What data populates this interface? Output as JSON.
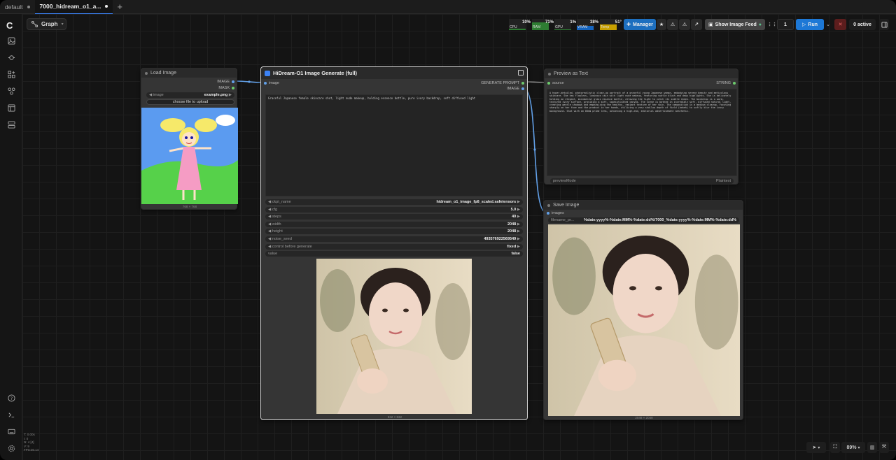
{
  "tabs": [
    {
      "label": "default"
    },
    {
      "label": "7000_hidream_o1_a..."
    }
  ],
  "toolbar": {
    "graph_label": "Graph",
    "meters": [
      {
        "label": "CPU",
        "value": "10%",
        "level": 0.1,
        "color": "#2e7d32"
      },
      {
        "label": "RAM",
        "value": "71%",
        "level": 0.71,
        "color": "#2e7d32"
      },
      {
        "label": "GPU",
        "value": "1%",
        "level": 0.01,
        "color": "#2e7d32"
      },
      {
        "label": "VRAM",
        "value": "38%",
        "level": 0.38,
        "color": "#1565c0"
      },
      {
        "label": "Temp",
        "value": "51°",
        "level": 0.51,
        "color": "#c8a000"
      }
    ],
    "manager_label": "Manager",
    "image_feed_label": "Show Image Feed",
    "queue_count": "1",
    "run_label": "Run",
    "active_label": "0 active",
    "accent": "#1d78d6"
  },
  "load_image": {
    "title": "Load Image",
    "out_image": "IMAGE",
    "out_mask": "MASK",
    "widget_label": "image",
    "widget_value": "example.png",
    "upload_label": "choose file to upload",
    "dims": "768 × 768"
  },
  "hidream": {
    "title": "HiDream-O1 Image Generate (full)",
    "in_image": "image",
    "out_prompt": "GENERATE PROMPT",
    "out_image": "IMAGE",
    "prompt": "Graceful Japanese female skincare shot, light nude makeup, holding essence bottle, pure ivory backdrop, soft diffused light",
    "widgets": [
      {
        "label": "ckpt_name",
        "value": "hidream_o1_image_fp8_scaled.safetensors"
      },
      {
        "label": "cfg",
        "value": "5.0"
      },
      {
        "label": "steps",
        "value": "40"
      },
      {
        "label": "width",
        "value": "2048"
      },
      {
        "label": "height",
        "value": "2048"
      },
      {
        "label": "noise_seed",
        "value": "493576922569549"
      },
      {
        "label": "control before generate",
        "value": "fixed"
      },
      {
        "label": "value",
        "value": "false"
      }
    ],
    "dims": "832 × 832"
  },
  "preview": {
    "title": "Preview as Text",
    "in_source": "source",
    "out_string": "STRING",
    "text": "A hyper-detailed, photorealistic close-up portrait of a graceful young Japanese woman, embodying serene beauty and meticulous skincare. She has flawless, luminous skin with light nude makeup, featuring subtle blush and dewy highlights. She is delicately holding an elegant, minimalist glass essence bottle, allowing the light to catch its subtle sheen. The backdrop is a warm, textured ivory surface, providing a soft, sophisticated canvas. The scene is bathed in incredibly soft, diffused natural light, creating gentle shadows and emphasizing the healthy, radiant texture of her skin. The composition is a medium closeup, focusing sharply on her face and the product in her hands, utilizing a very shallow depth of field (bokeh) to softly blur the ivory background. Shot with an 85mm prime lens, achieving a high-end, editorial advertisement aesthetic.",
    "mode_label": "previewMode",
    "mode_value": "Plaintext"
  },
  "save_image": {
    "title": "Save Image",
    "in_images": "images",
    "prefix_label": "filename_pr...",
    "prefix_value": "%date:yyyy%-%date:MM%-%date:dd%/7000_%date:yyyy%-%date:MM%-%date:dd%",
    "dims": "2048 × 2048"
  },
  "stats": [
    "T: 0.00s",
    "I: 0",
    "N: 4 [4]",
    "V: 9",
    "FPS:30.14"
  ],
  "zoom": "89%"
}
